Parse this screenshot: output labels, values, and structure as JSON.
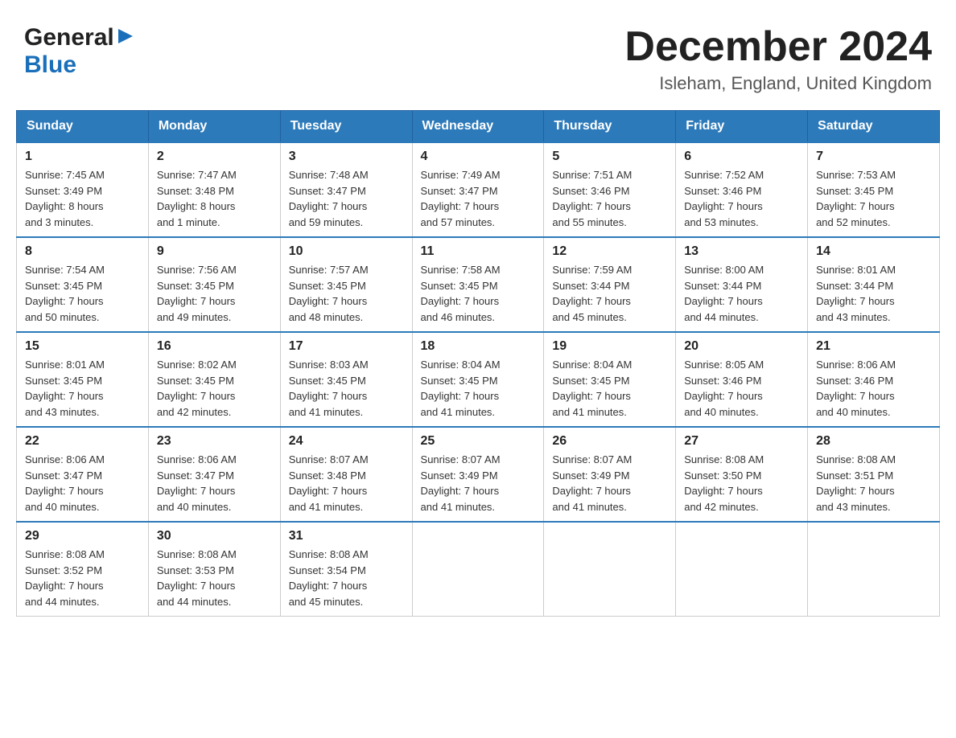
{
  "header": {
    "logo_general": "General",
    "logo_blue": "Blue",
    "month_year": "December 2024",
    "location": "Isleham, England, United Kingdom"
  },
  "weekdays": [
    "Sunday",
    "Monday",
    "Tuesday",
    "Wednesday",
    "Thursday",
    "Friday",
    "Saturday"
  ],
  "weeks": [
    [
      {
        "day": "1",
        "sunrise": "7:45 AM",
        "sunset": "3:49 PM",
        "daylight": "8 hours and 3 minutes."
      },
      {
        "day": "2",
        "sunrise": "7:47 AM",
        "sunset": "3:48 PM",
        "daylight": "8 hours and 1 minute."
      },
      {
        "day": "3",
        "sunrise": "7:48 AM",
        "sunset": "3:47 PM",
        "daylight": "7 hours and 59 minutes."
      },
      {
        "day": "4",
        "sunrise": "7:49 AM",
        "sunset": "3:47 PM",
        "daylight": "7 hours and 57 minutes."
      },
      {
        "day": "5",
        "sunrise": "7:51 AM",
        "sunset": "3:46 PM",
        "daylight": "7 hours and 55 minutes."
      },
      {
        "day": "6",
        "sunrise": "7:52 AM",
        "sunset": "3:46 PM",
        "daylight": "7 hours and 53 minutes."
      },
      {
        "day": "7",
        "sunrise": "7:53 AM",
        "sunset": "3:45 PM",
        "daylight": "7 hours and 52 minutes."
      }
    ],
    [
      {
        "day": "8",
        "sunrise": "7:54 AM",
        "sunset": "3:45 PM",
        "daylight": "7 hours and 50 minutes."
      },
      {
        "day": "9",
        "sunrise": "7:56 AM",
        "sunset": "3:45 PM",
        "daylight": "7 hours and 49 minutes."
      },
      {
        "day": "10",
        "sunrise": "7:57 AM",
        "sunset": "3:45 PM",
        "daylight": "7 hours and 48 minutes."
      },
      {
        "day": "11",
        "sunrise": "7:58 AM",
        "sunset": "3:45 PM",
        "daylight": "7 hours and 46 minutes."
      },
      {
        "day": "12",
        "sunrise": "7:59 AM",
        "sunset": "3:44 PM",
        "daylight": "7 hours and 45 minutes."
      },
      {
        "day": "13",
        "sunrise": "8:00 AM",
        "sunset": "3:44 PM",
        "daylight": "7 hours and 44 minutes."
      },
      {
        "day": "14",
        "sunrise": "8:01 AM",
        "sunset": "3:44 PM",
        "daylight": "7 hours and 43 minutes."
      }
    ],
    [
      {
        "day": "15",
        "sunrise": "8:01 AM",
        "sunset": "3:45 PM",
        "daylight": "7 hours and 43 minutes."
      },
      {
        "day": "16",
        "sunrise": "8:02 AM",
        "sunset": "3:45 PM",
        "daylight": "7 hours and 42 minutes."
      },
      {
        "day": "17",
        "sunrise": "8:03 AM",
        "sunset": "3:45 PM",
        "daylight": "7 hours and 41 minutes."
      },
      {
        "day": "18",
        "sunrise": "8:04 AM",
        "sunset": "3:45 PM",
        "daylight": "7 hours and 41 minutes."
      },
      {
        "day": "19",
        "sunrise": "8:04 AM",
        "sunset": "3:45 PM",
        "daylight": "7 hours and 41 minutes."
      },
      {
        "day": "20",
        "sunrise": "8:05 AM",
        "sunset": "3:46 PM",
        "daylight": "7 hours and 40 minutes."
      },
      {
        "day": "21",
        "sunrise": "8:06 AM",
        "sunset": "3:46 PM",
        "daylight": "7 hours and 40 minutes."
      }
    ],
    [
      {
        "day": "22",
        "sunrise": "8:06 AM",
        "sunset": "3:47 PM",
        "daylight": "7 hours and 40 minutes."
      },
      {
        "day": "23",
        "sunrise": "8:06 AM",
        "sunset": "3:47 PM",
        "daylight": "7 hours and 40 minutes."
      },
      {
        "day": "24",
        "sunrise": "8:07 AM",
        "sunset": "3:48 PM",
        "daylight": "7 hours and 41 minutes."
      },
      {
        "day": "25",
        "sunrise": "8:07 AM",
        "sunset": "3:49 PM",
        "daylight": "7 hours and 41 minutes."
      },
      {
        "day": "26",
        "sunrise": "8:07 AM",
        "sunset": "3:49 PM",
        "daylight": "7 hours and 41 minutes."
      },
      {
        "day": "27",
        "sunrise": "8:08 AM",
        "sunset": "3:50 PM",
        "daylight": "7 hours and 42 minutes."
      },
      {
        "day": "28",
        "sunrise": "8:08 AM",
        "sunset": "3:51 PM",
        "daylight": "7 hours and 43 minutes."
      }
    ],
    [
      {
        "day": "29",
        "sunrise": "8:08 AM",
        "sunset": "3:52 PM",
        "daylight": "7 hours and 44 minutes."
      },
      {
        "day": "30",
        "sunrise": "8:08 AM",
        "sunset": "3:53 PM",
        "daylight": "7 hours and 44 minutes."
      },
      {
        "day": "31",
        "sunrise": "8:08 AM",
        "sunset": "3:54 PM",
        "daylight": "7 hours and 45 minutes."
      },
      null,
      null,
      null,
      null
    ]
  ],
  "labels": {
    "sunrise": "Sunrise:",
    "sunset": "Sunset:",
    "daylight": "Daylight:"
  }
}
